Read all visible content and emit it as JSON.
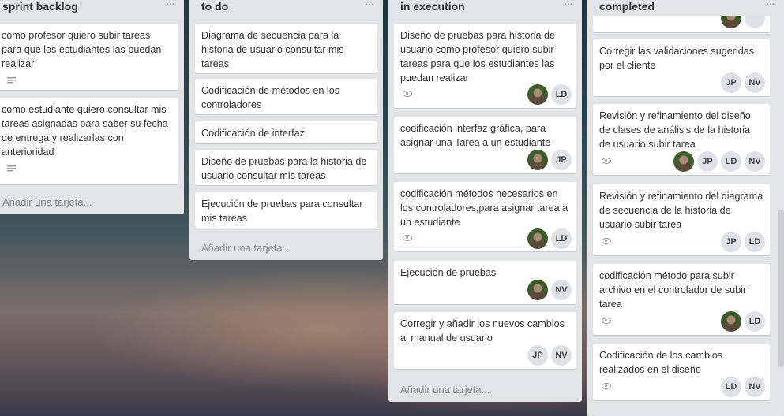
{
  "lists": [
    {
      "title": "sprint backlog",
      "menu": "···",
      "add_card": "Añadir una tarjeta...",
      "cards": [
        {
          "title": "como profesor quiero subir tareas para que los estudiantes las puedan realizar"
        },
        {
          "title": "como estudiante quiero consultar mis tareas asignadas para saber su fecha de entrega y realizarlas con anterioridad"
        }
      ]
    },
    {
      "title": "to do",
      "menu": "···",
      "add_card": "Añadir una tarjeta...",
      "cards": [
        {
          "title": "Diagrama de secuencia para la historia de usuario consultar mis tareas"
        },
        {
          "title": "Codificación de métodos en los controladores"
        },
        {
          "title": "Codificación de interfaz"
        },
        {
          "title": "Diseño de pruebas para la historia de usuario consultar mis tareas"
        },
        {
          "title": "Ejecución de pruebas para consultar mis tareas"
        }
      ]
    },
    {
      "title": "in execution",
      "menu": "···",
      "add_card": "Añadir una tarjeta...",
      "cards": [
        {
          "title": "Diseño de pruebas para historia de usuario como profesor quiero subir tareas para que los estudiantes las puedan realizar",
          "members": [
            "LD"
          ]
        },
        {
          "title": "codificación interfaz gráfica, para asignar una Tarea a un estudiante",
          "members": [
            "JP"
          ]
        },
        {
          "title": "codificación métodos necesarios en los controladores,para asignar tarea a un estudiante",
          "members": [
            "LD"
          ]
        },
        {
          "title": "Ejecución de pruebas",
          "members": [
            "NV"
          ]
        },
        {
          "title": "Corregir y añadir los nuevos cambios al manual de usuario",
          "members": [
            "JP",
            "NV"
          ]
        }
      ]
    },
    {
      "title": "completed",
      "menu": "···",
      "cards": [
        {
          "title": "Corregir las validaciones sugeridas por el cliente",
          "members": [
            "JP",
            "NV"
          ]
        },
        {
          "title": "Revisión y refinamiento del diseño de clases de análisis de la historia de usuario subir tarea",
          "members": [
            "JP",
            "LD",
            "NV"
          ]
        },
        {
          "title": "Revisión y refinamiento del diagrama de secuencia de la historia de usuario subir tarea",
          "members": [
            "JP",
            "LD"
          ]
        },
        {
          "title": "codificación método para subir archivo en el controlador de subir tarea",
          "members": [
            "LD"
          ]
        },
        {
          "title": "Codificación de los cambios realizados en el diseño",
          "members": [
            "LD",
            "NV"
          ]
        }
      ]
    }
  ]
}
